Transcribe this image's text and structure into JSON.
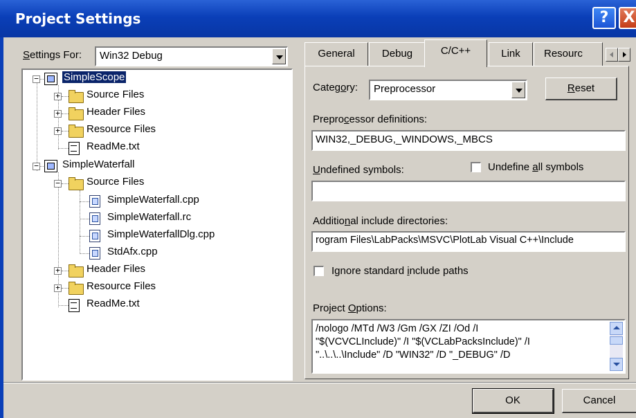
{
  "window": {
    "title": "Project Settings",
    "help_glyph": "?",
    "close_glyph": "X"
  },
  "settings_for": {
    "label_prefix": "",
    "label_u": "S",
    "label_rest": "ettings For:",
    "value": "Win32 Debug"
  },
  "tree": [
    {
      "label": "SimpleScope",
      "icon": "project-icon",
      "selected": true
    },
    {
      "label": "Source Files",
      "icon": "folder-icon"
    },
    {
      "label": "Header Files",
      "icon": "folder-icon"
    },
    {
      "label": "Resource Files",
      "icon": "folder-icon"
    },
    {
      "label": "ReadMe.txt",
      "icon": "document-icon"
    },
    {
      "label": "SimpleWaterfall",
      "icon": "project-icon"
    },
    {
      "label": "Source Files",
      "icon": "open-folder-icon"
    },
    {
      "label": "SimpleWaterfall.cpp",
      "icon": "cpp-file-icon"
    },
    {
      "label": "SimpleWaterfall.rc",
      "icon": "cpp-file-icon"
    },
    {
      "label": "SimpleWaterfallDlg.cpp",
      "icon": "cpp-file-icon"
    },
    {
      "label": "StdAfx.cpp",
      "icon": "cpp-file-icon"
    },
    {
      "label": "Header Files",
      "icon": "folder-icon"
    },
    {
      "label": "Resource Files",
      "icon": "folder-icon"
    },
    {
      "label": "ReadMe.txt",
      "icon": "document-icon"
    }
  ],
  "tabs": [
    {
      "label": "General"
    },
    {
      "label": "Debug"
    },
    {
      "label": "C/C++",
      "active": true
    },
    {
      "label": "Link"
    },
    {
      "label": "Resourc"
    }
  ],
  "category": {
    "label_prefix": "Categ",
    "label_u": "o",
    "label_rest": "ry:",
    "value": "Preprocessor"
  },
  "reset": {
    "label_u": "R",
    "label_rest": "eset"
  },
  "preprocessor": {
    "label_prefix": "Prepro",
    "label_u": "c",
    "label_rest": "essor definitions:",
    "value": "WIN32,_DEBUG,_WINDOWS,_MBCS"
  },
  "undefined": {
    "label_u": "U",
    "label_rest": "ndefined symbols:",
    "value": ""
  },
  "undefine_all": {
    "label_prefix": "Undefine ",
    "label_u": "a",
    "label_rest": "ll symbols",
    "checked": false
  },
  "include_dirs": {
    "label_prefix": "Additio",
    "label_u": "n",
    "label_rest": "al include directories:",
    "value": "rogram Files\\LabPacks\\MSVC\\PlotLab Visual C++\\Include"
  },
  "ignore_std": {
    "label_prefix": "Ignore standard ",
    "label_u": "i",
    "label_rest": "nclude paths",
    "checked": false
  },
  "project_options": {
    "label_prefix": "Project ",
    "label_u": "O",
    "label_rest": "ptions:",
    "lines": [
      "/nologo /MTd /W3 /Gm /GX /ZI /Od /I",
      "\"$(VCVCLInclude)\" /I \"$(VCLabPacksInclude)\" /I",
      "\"..\\..\\..\\Include\" /D \"WIN32\" /D \"_DEBUG\" /D"
    ]
  },
  "ok": {
    "label_u": "",
    "label": "OK"
  },
  "cancel": {
    "label": "Cancel"
  }
}
